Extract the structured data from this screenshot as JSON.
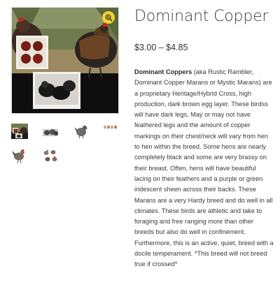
{
  "product": {
    "title": "Dominant Copper",
    "price": "$3.00 – $4.85",
    "description_lead": "Dominant Coppers",
    "description_body": " (aka Rustic Rambler, Dominant Copper Marans or Mystic Marans) are a proprietary Heritage/Hybrid Cross, high production, dark brown egg layer.  These birdss will have dark legs, May or may not have feathered legs and the amount of copper markings on their chest/neck will vary from hen to hen within the breed.  Some hens are nearly completely black and some are very brassy on their breast.  Often, hens will have beautiful lacing on their feathers and a purple or green iridescent sheen across their backs.  These Marans are a very Hardy breed and do well in all climates.  These birds are athletic and take to foraging and free ranging more than other breeds but also do well in confinement.  Furthermore, this is an active, quiet, breed with a docile temperament.  *This breed will not breed true if crossed*"
  },
  "gallery": {
    "zoom_icon": "magnifier-icon",
    "zoom_color": "#f2d22e",
    "thumbnails": [
      {
        "name": "thumb-collage",
        "icon": "hen-collage-icon"
      },
      {
        "name": "thumb-chicks",
        "icon": "chicks-icon"
      },
      {
        "name": "thumb-hen",
        "icon": "hen-icon"
      },
      {
        "name": "thumb-eggs",
        "icon": "eggs-row-icon"
      },
      {
        "name": "thumb-rooster",
        "icon": "rooster-icon"
      },
      {
        "name": "thumb-hen-group",
        "icon": "hen-group-icon"
      }
    ]
  }
}
